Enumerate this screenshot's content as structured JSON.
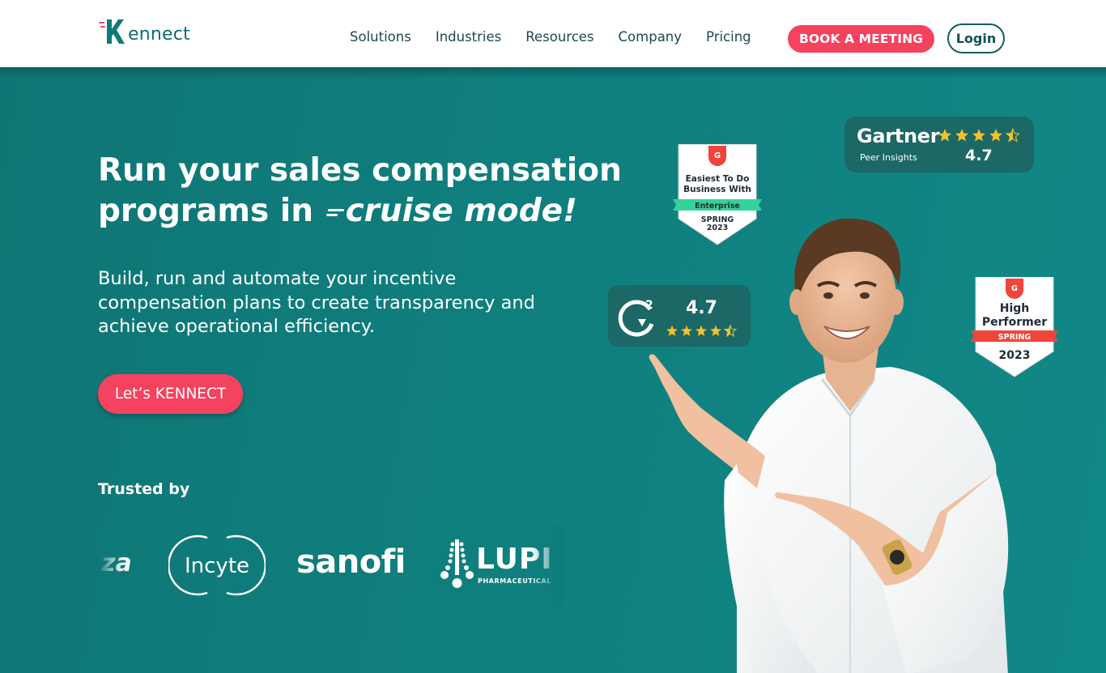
{
  "nav": {
    "logo_text": "ennect",
    "links": [
      "Solutions",
      "Industries",
      "Resources",
      "Company",
      "Pricing"
    ],
    "book_label": "BOOK A MEETING",
    "login_label": "Login"
  },
  "hero": {
    "headline_line1": "Run your sales compensation",
    "headline_line2_prefix": "programs in ",
    "headline_line2_emphasis": "cruise mode!",
    "subheading": "Build, run and  automate your incentive compensation plans to create transparency and achieve operational efficiency.",
    "cta_label": "Let’s KENNECT",
    "trusted_label": "Trusted by"
  },
  "client_logos": {
    "astrazeneca_fragment": "za",
    "incyte": "Incyte",
    "sanofi": "sanofi",
    "lupin": "LUPI",
    "lupin_sub": "PHARMACEUTICAL"
  },
  "badges": {
    "g2_easiest": {
      "line1": "Easiest To Do",
      "line2": "Business With",
      "ribbon": "Enterprise",
      "season": "SPRING",
      "year": "2023"
    },
    "g2_high": {
      "line1": "High",
      "line2": "Performer",
      "ribbon": "SPRING",
      "year": "2023"
    },
    "gartner": {
      "brand": "Gartner",
      "sub": "Peer Insights",
      "score": "4.7",
      "stars": 4.5
    },
    "g2_rating": {
      "score": "4.7",
      "stars": 4.5
    }
  },
  "colors": {
    "brand_teal": "#0e7f7f",
    "accent_pink": "#f5425e",
    "g2_red": "#f0453a",
    "star_yellow": "#f7c12b"
  }
}
